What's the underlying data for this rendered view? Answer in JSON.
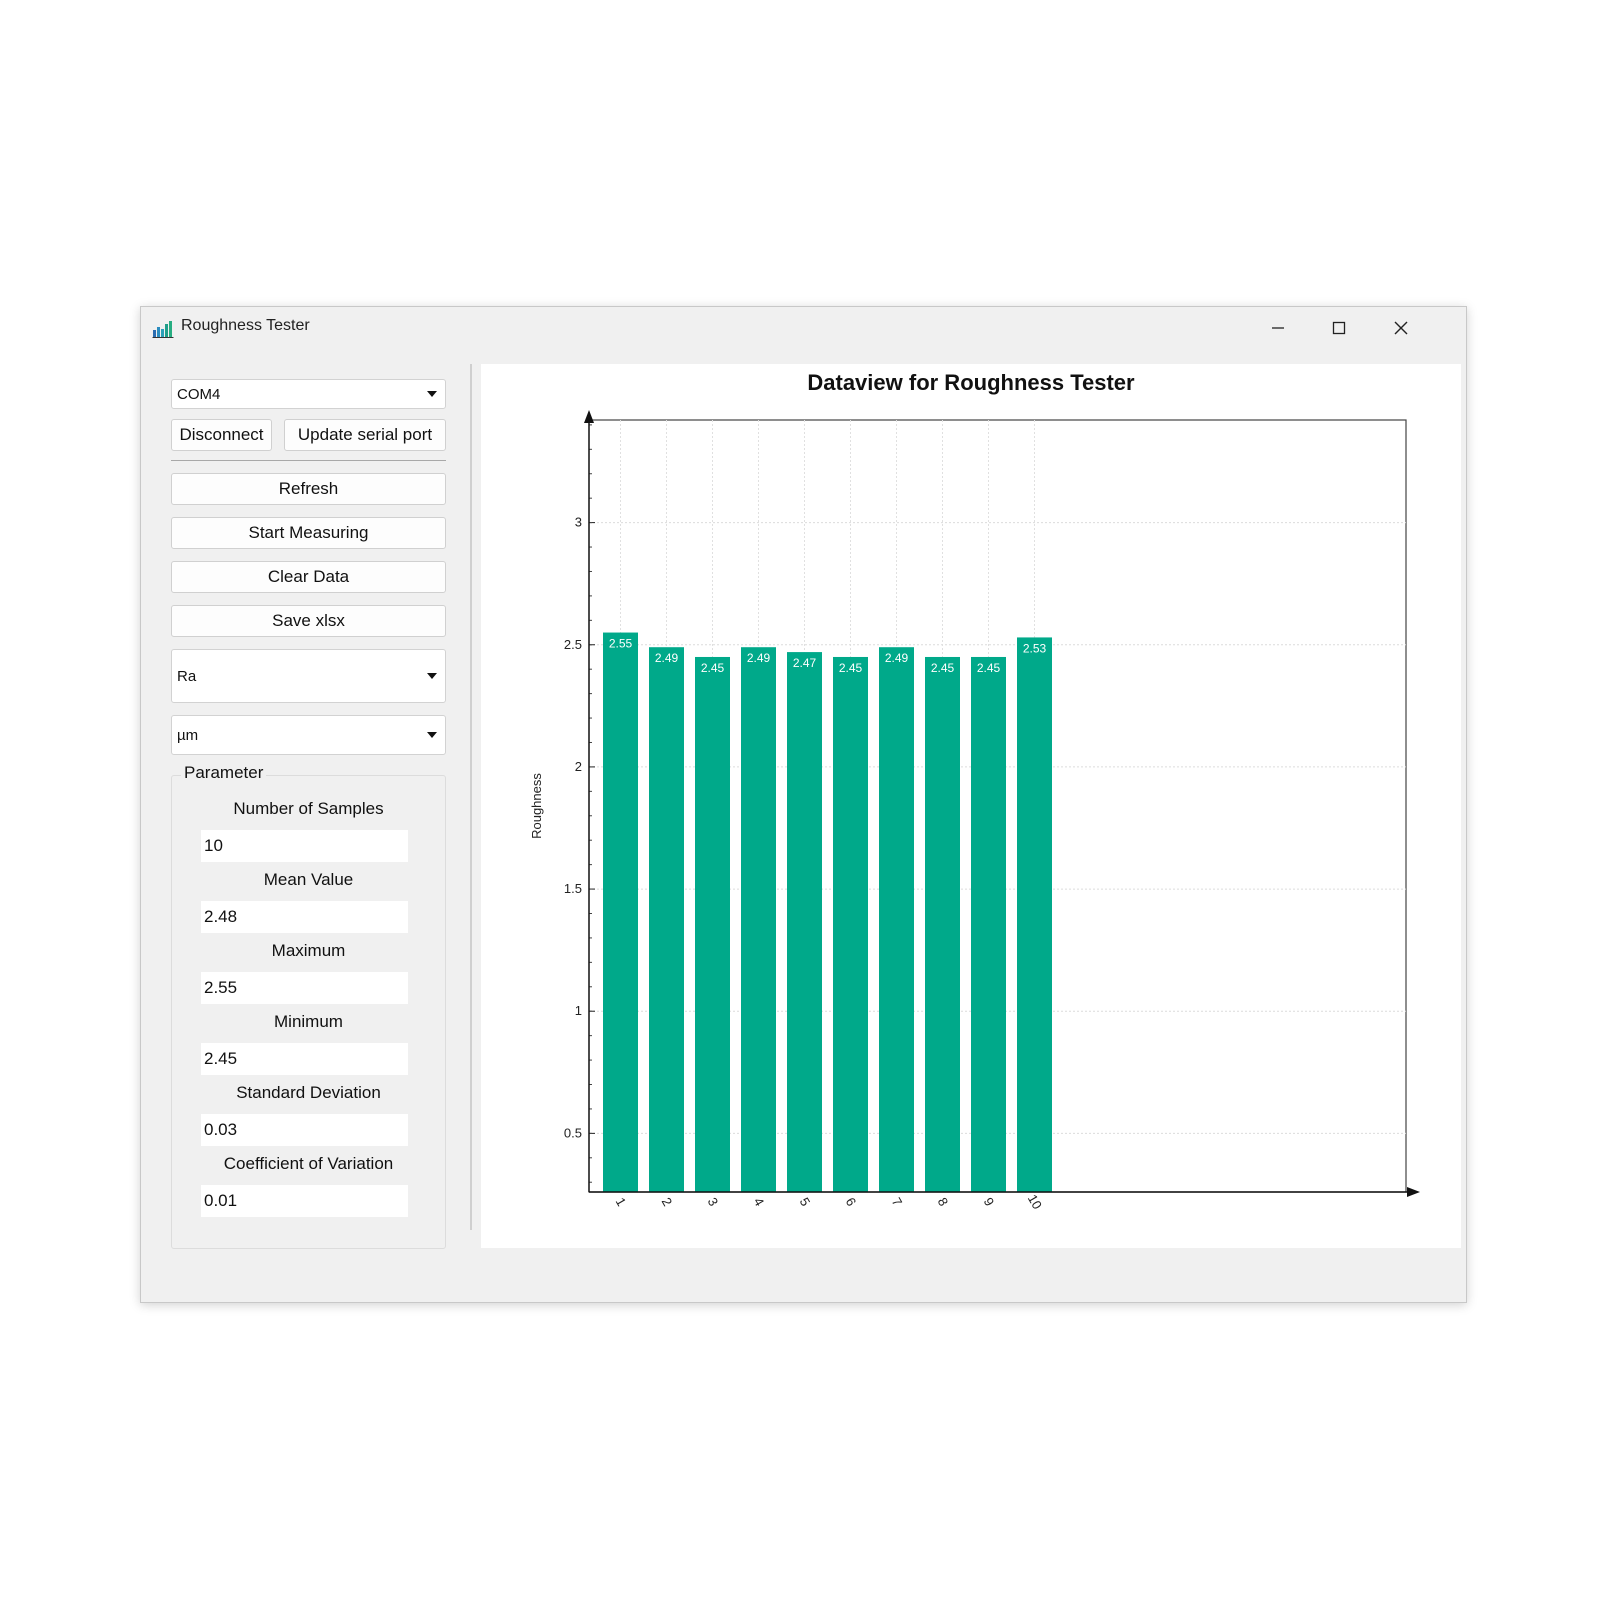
{
  "window": {
    "title": "Roughness Tester",
    "icons": {
      "app": "bar-chart-icon",
      "minimize": "minimize-icon",
      "maximize": "maximize-icon",
      "close": "close-icon"
    }
  },
  "controls": {
    "port_select": "COM4",
    "disconnect_label": "Disconnect",
    "update_port_label": "Update serial port",
    "refresh_label": "Refresh",
    "start_label": "Start Measuring",
    "clear_label": "Clear Data",
    "save_label": "Save xlsx",
    "parameter_select": "Ra",
    "unit_select": "µm"
  },
  "parameters": {
    "title": "Parameter",
    "samples_label": "Number of Samples",
    "samples_value": "10",
    "mean_label": "Mean Value",
    "mean_value": "2.48",
    "max_label": "Maximum",
    "max_value": "2.55",
    "min_label": "Minimum",
    "min_value": "2.45",
    "std_label": "Standard Deviation",
    "std_value": "0.03",
    "cv_label": "Coefficient of Variation",
    "cv_value": "0.01"
  },
  "chart_data": {
    "type": "bar",
    "title": "Dataview for Roughness Tester",
    "xlabel": "",
    "ylabel": "Roughness",
    "categories": [
      "1",
      "2",
      "3",
      "4",
      "5",
      "6",
      "7",
      "8",
      "9",
      "10"
    ],
    "values": [
      2.55,
      2.49,
      2.45,
      2.49,
      2.47,
      2.45,
      2.49,
      2.45,
      2.45,
      2.53
    ],
    "value_labels": [
      "2.55",
      "2.49",
      "2.45",
      "2.49",
      "2.47",
      "2.45",
      "2.49",
      "2.45",
      "2.45",
      "2.53"
    ],
    "yticks": [
      "0.5",
      "1",
      "1.5",
      "2",
      "2.5",
      "3"
    ],
    "ylim": [
      0.26,
      3.42
    ],
    "grid": true,
    "bar_color": "#00a98a"
  }
}
